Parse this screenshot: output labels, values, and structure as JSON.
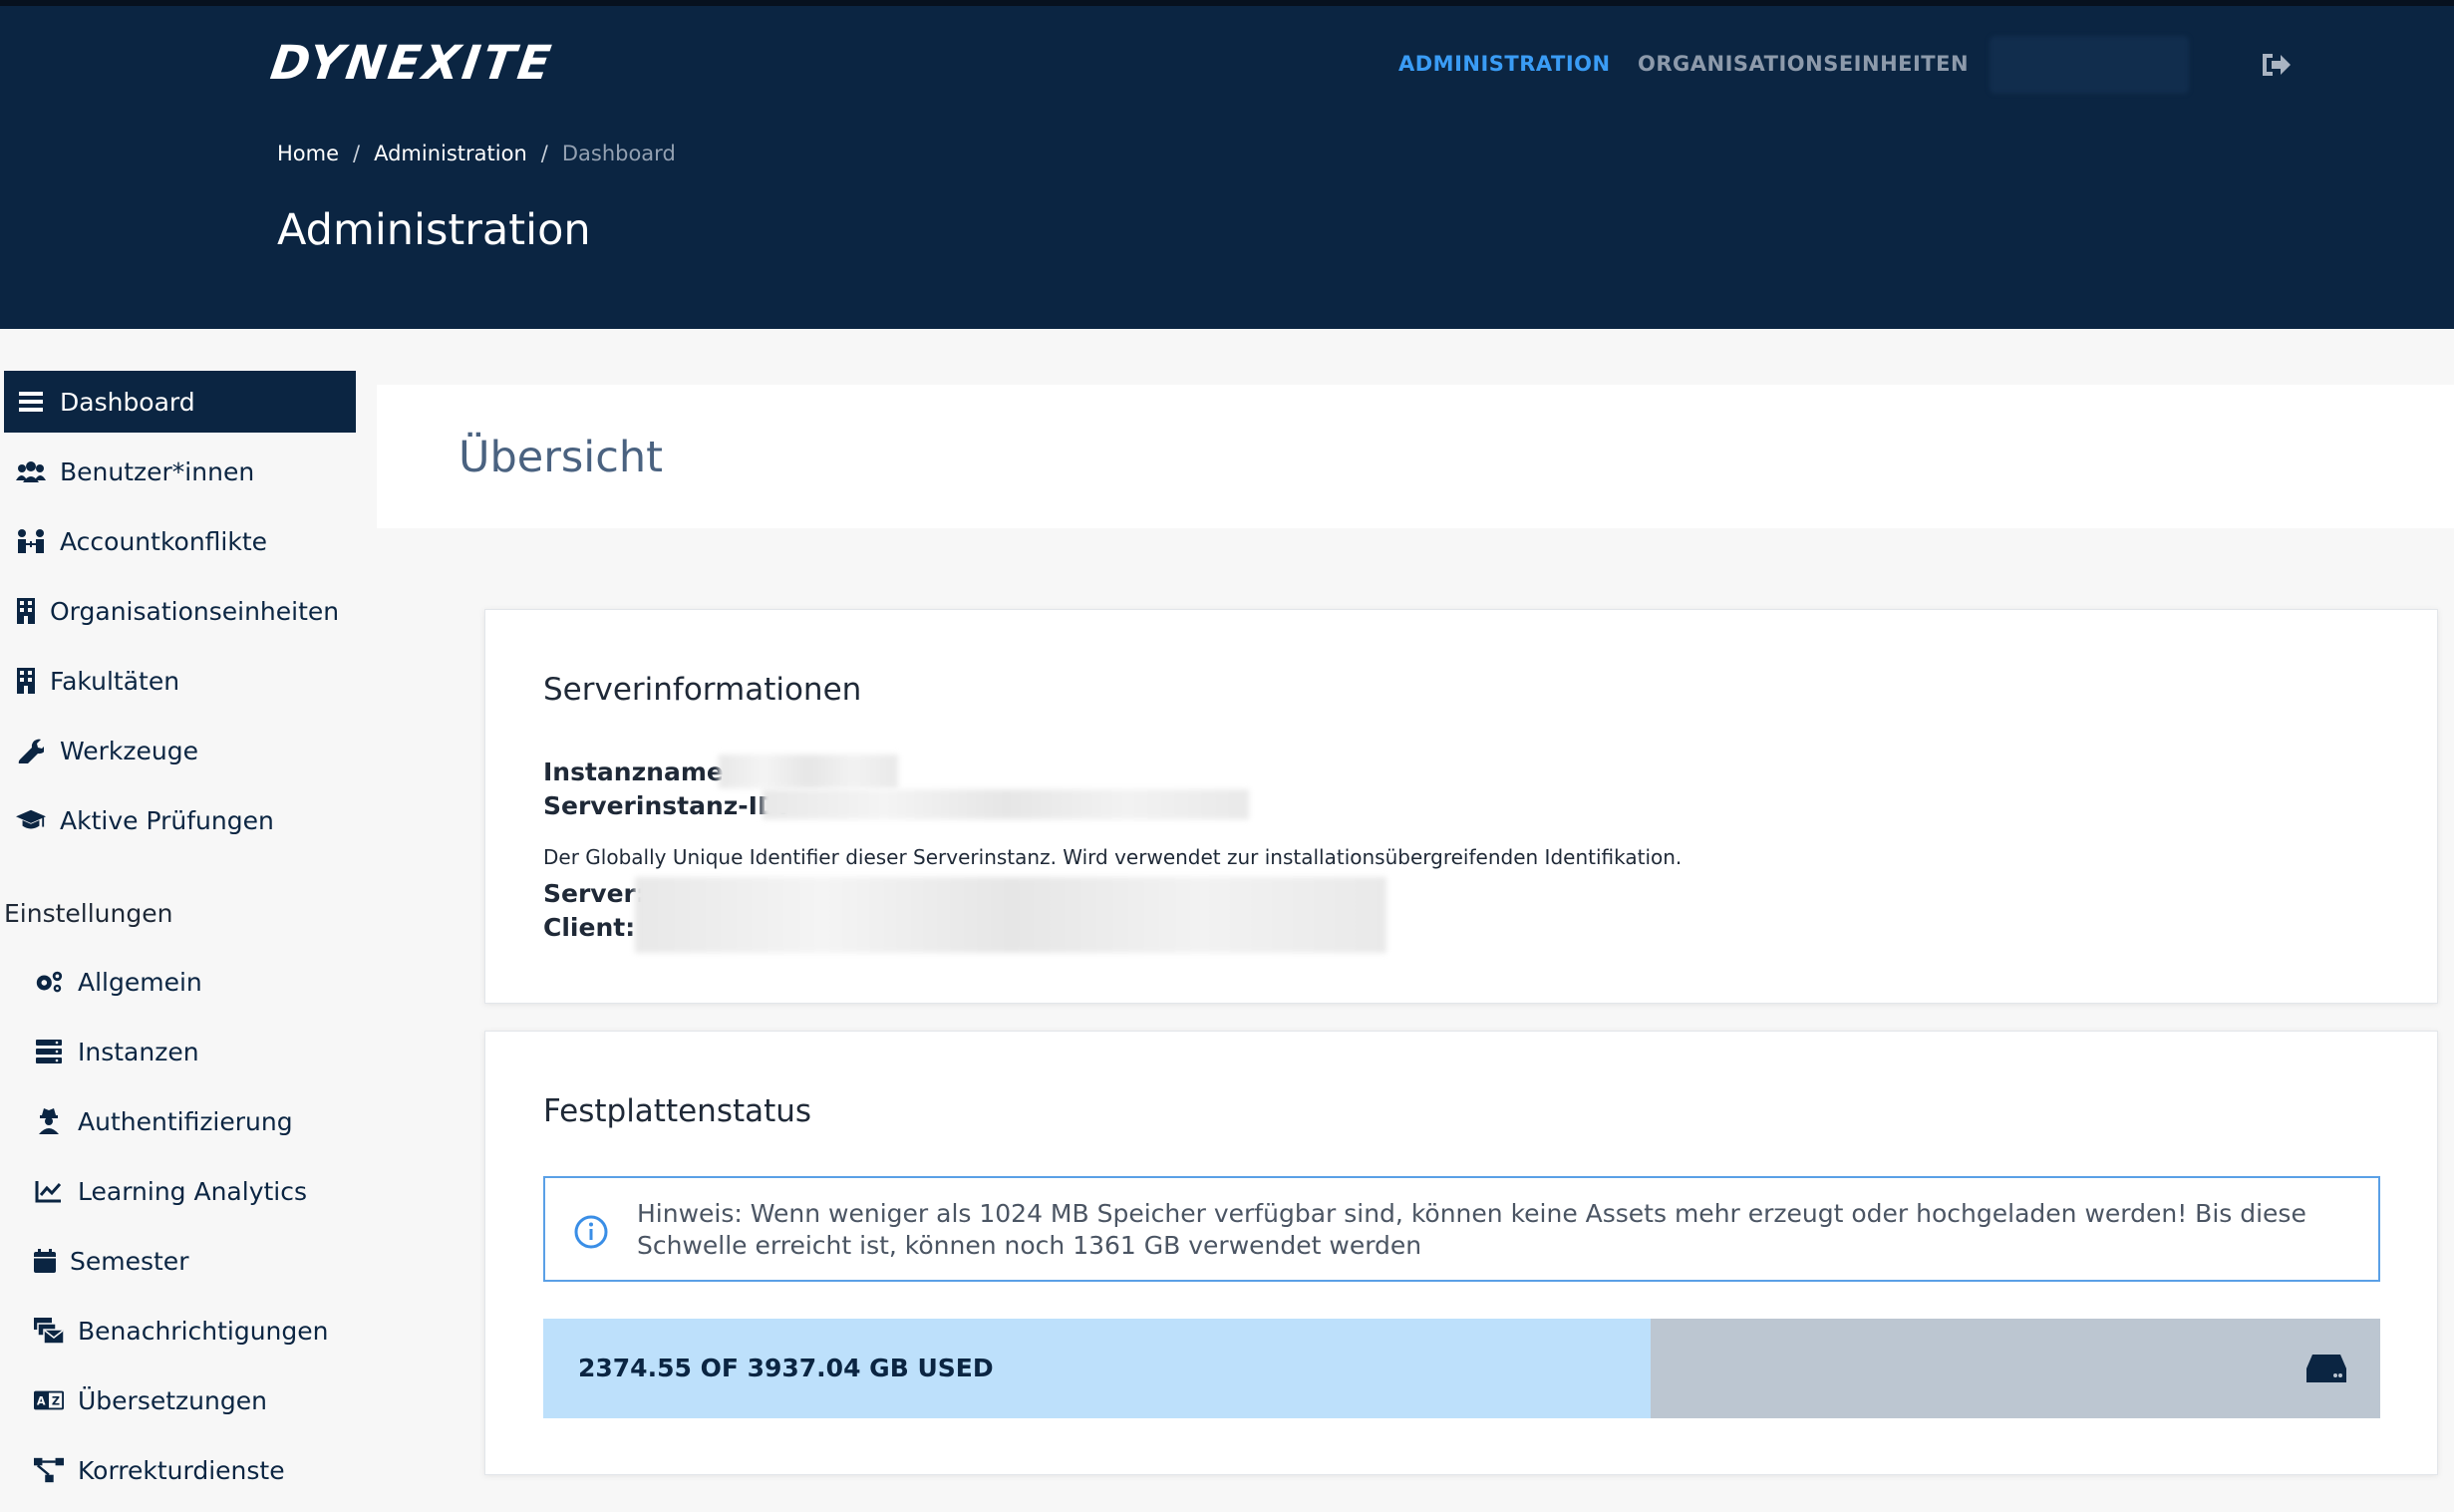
{
  "header": {
    "logo": "DYNEXITE",
    "nav": [
      "ADMINISTRATION",
      "ORGANISATIONSEINHEITEN"
    ],
    "breadcrumb": [
      "Home",
      "Administration",
      "Dashboard"
    ],
    "title": "Administration"
  },
  "sidebar": {
    "items": [
      {
        "label": "Dashboard",
        "icon": "list-icon"
      },
      {
        "label": "Benutzer*innen",
        "icon": "users-icon"
      },
      {
        "label": "Accountkonflikte",
        "icon": "user-conflict-icon"
      },
      {
        "label": "Organisationseinheiten",
        "icon": "building-icon"
      },
      {
        "label": "Fakultäten",
        "icon": "building-icon"
      },
      {
        "label": "Werkzeuge",
        "icon": "wrench-icon"
      },
      {
        "label": "Aktive Prüfungen",
        "icon": "graduation-cap-icon"
      }
    ],
    "settings_heading": "Einstellungen",
    "settings": [
      {
        "label": "Allgemein",
        "icon": "gears-icon"
      },
      {
        "label": "Instanzen",
        "icon": "server-icon"
      },
      {
        "label": "Authentifizierung",
        "icon": "user-secret-icon"
      },
      {
        "label": "Learning Analytics",
        "icon": "chart-line-icon"
      },
      {
        "label": "Semester",
        "icon": "calendar-icon"
      },
      {
        "label": "Benachrichtigungen",
        "icon": "mail-bulk-icon"
      },
      {
        "label": "Übersetzungen",
        "icon": "language-icon"
      },
      {
        "label": "Korrekturdienste",
        "icon": "project-diagram-icon"
      }
    ]
  },
  "main": {
    "overview_title": "Übersicht",
    "server_card": {
      "title": "Serverinformationen",
      "instance_name_label": "Instanzname:",
      "instance_id_label": "Serverinstanz-ID:",
      "instance_id_hint": "Der Globally Unique Identifier dieser Serverinstanz. Wird verwendet zur installationsübergreifenden Identifikation.",
      "server_label": "Server:",
      "client_label": "Client:"
    },
    "disk_card": {
      "title": "Festplattenstatus",
      "hint": "Hinweis: Wenn weniger als 1024 MB Speicher verfügbar sind, können keine Assets mehr erzeugt oder hochgeladen werden! Bis diese Schwelle erreicht ist, können noch 1361 GB verwendet werden",
      "usage_text": "2374.55 OF 3937.04 GB USED",
      "used_fraction": 0.603
    }
  },
  "colors": {
    "header_bg": "#0b2542",
    "accent": "#3a9cf5",
    "progress_fill": "#bde0fb",
    "progress_track": "#bcc6d1"
  }
}
